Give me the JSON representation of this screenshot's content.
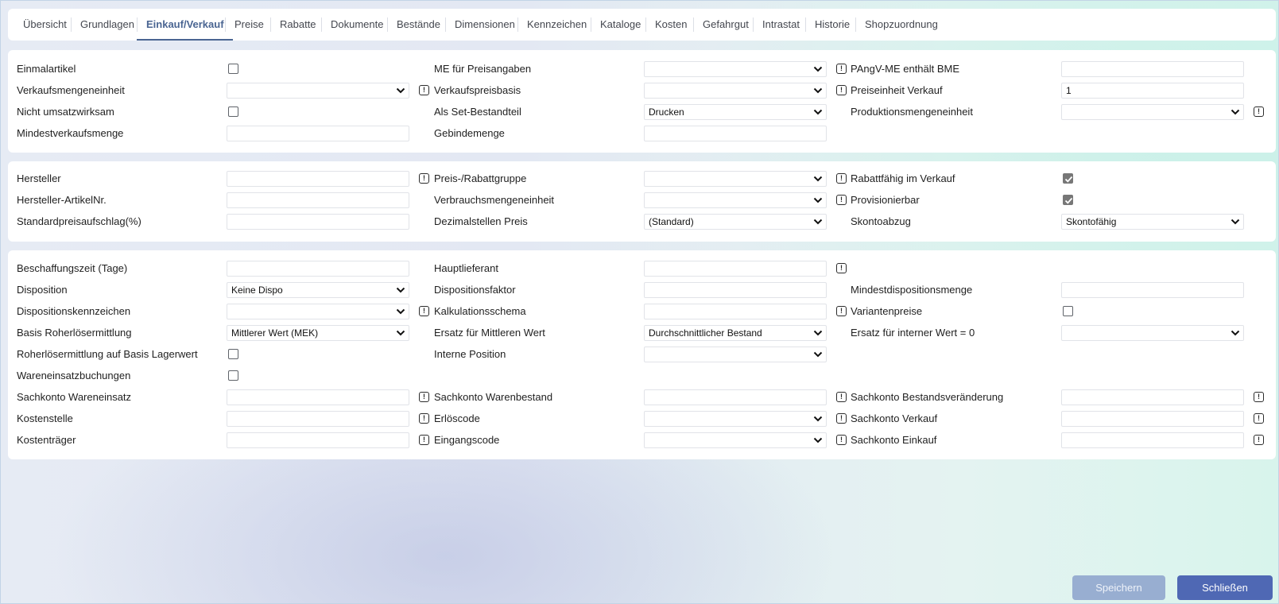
{
  "tabs": [
    {
      "label": "Übersicht"
    },
    {
      "label": "Grundlagen"
    },
    {
      "label": "Einkauf/Verkauf"
    },
    {
      "label": "Preise"
    },
    {
      "label": "Rabatte"
    },
    {
      "label": "Dokumente"
    },
    {
      "label": "Bestände"
    },
    {
      "label": "Dimensionen"
    },
    {
      "label": "Kennzeichen"
    },
    {
      "label": "Kataloge"
    },
    {
      "label": "Kosten"
    },
    {
      "label": "Gefahrgut"
    },
    {
      "label": "Intrastat"
    },
    {
      "label": "Historie"
    },
    {
      "label": "Shopzuordnung"
    }
  ],
  "active_tab": "Einkauf/Verkauf",
  "verkauf": {
    "einmalartikel": {
      "label": "Einmalartikel",
      "checked": false
    },
    "verkaufsmengeneinheit": {
      "label": "Verkaufsmengeneinheit",
      "value": ""
    },
    "nicht_umsatzwirksam": {
      "label": "Nicht umsatzwirksam",
      "checked": false
    },
    "mindestverkaufsmenge": {
      "label": "Mindestverkaufsmenge",
      "value": ""
    },
    "me_preisangaben": {
      "label": "ME für Preisangaben",
      "value": ""
    },
    "verkaufspreisbasis": {
      "label": "Verkaufspreisbasis",
      "value": ""
    },
    "set_bestandteil": {
      "label": "Als Set-Bestandteil",
      "value": "Drucken"
    },
    "gebindemenge": {
      "label": "Gebindemenge",
      "value": ""
    },
    "pangv_me": {
      "label": "PAngV-ME enthält BME",
      "value": ""
    },
    "preiseinheit_verkauf": {
      "label": "Preiseinheit Verkauf",
      "value": "1"
    },
    "produktionsmengeneinheit": {
      "label": "Produktionsmengeneinheit",
      "value": ""
    }
  },
  "hersteller": {
    "hersteller": {
      "label": "Hersteller",
      "value": ""
    },
    "hersteller_artikelnr": {
      "label": "Hersteller-ArtikelNr.",
      "value": ""
    },
    "standardpreisaufschlag": {
      "label": "Standardpreisaufschlag(%)",
      "value": ""
    },
    "preis_rabattgruppe": {
      "label": "Preis-/Rabattgruppe",
      "value": ""
    },
    "verbrauchsmengeneinheit": {
      "label": "Verbrauchsmengeneinheit",
      "value": ""
    },
    "dezimalstellen_preis": {
      "label": "Dezimalstellen Preis",
      "value": "(Standard)"
    },
    "rabattfaehig": {
      "label": "Rabattfähig im Verkauf",
      "checked": true
    },
    "provisionierbar": {
      "label": "Provisionierbar",
      "checked": true
    },
    "skontoabzug": {
      "label": "Skontoabzug",
      "value": "Skontofähig"
    }
  },
  "einkauf": {
    "beschaffungszeit": {
      "label": "Beschaffungszeit (Tage)",
      "value": ""
    },
    "disposition": {
      "label": "Disposition",
      "value": "Keine Dispo"
    },
    "dispositionskennzeichen": {
      "label": "Dispositionskennzeichen",
      "value": ""
    },
    "basis_roherloes": {
      "label": "Basis Roherlösermittlung",
      "value": "Mittlerer Wert (MEK)"
    },
    "roherloes_lagerwert": {
      "label": "Roherlösermittlung auf Basis Lagerwert",
      "checked": false
    },
    "wareneinsatzbuchungen": {
      "label": "Wareneinsatzbuchungen",
      "checked": false
    },
    "sachkonto_wareneinsatz": {
      "label": "Sachkonto Wareneinsatz",
      "value": ""
    },
    "kostenstelle": {
      "label": "Kostenstelle",
      "value": ""
    },
    "kostentraeger": {
      "label": "Kostenträger",
      "value": ""
    },
    "hauptlieferant": {
      "label": "Hauptlieferant",
      "value": ""
    },
    "dispositionsfaktor": {
      "label": "Dispositionsfaktor",
      "value": ""
    },
    "kalkulationsschema": {
      "label": "Kalkulationsschema",
      "value": ""
    },
    "ersatz_mittlerer_wert": {
      "label": "Ersatz für Mittleren Wert",
      "value": "Durchschnittlicher Bestand"
    },
    "interne_position": {
      "label": "Interne Position",
      "value": ""
    },
    "sachkonto_warenbestand": {
      "label": "Sachkonto Warenbestand",
      "value": ""
    },
    "erloescode": {
      "label": "Erlöscode",
      "value": ""
    },
    "eingangscode": {
      "label": "Eingangscode",
      "value": ""
    },
    "mindestdispositionsmenge": {
      "label": "Mindestdispositionsmenge",
      "value": ""
    },
    "variantenpreise": {
      "label": "Variantenpreise",
      "checked": false
    },
    "ersatz_interner_wert": {
      "label": "Ersatz für interner Wert = 0",
      "value": ""
    },
    "sachkonto_bestandsveraenderung": {
      "label": "Sachkonto Bestandsveränderung",
      "value": ""
    },
    "sachkonto_verkauf": {
      "label": "Sachkonto Verkauf",
      "value": ""
    },
    "sachkonto_einkauf": {
      "label": "Sachkonto Einkauf",
      "value": ""
    }
  },
  "buttons": {
    "save": "Speichern",
    "close": "Schließen"
  },
  "colors": {
    "accent": "#4a6592",
    "primary_button": "#4f68b4",
    "disabled_button": "#98aed1"
  },
  "icons": {
    "info": "info-icon",
    "chevron": "chevron-down-icon",
    "check": "check-icon"
  }
}
